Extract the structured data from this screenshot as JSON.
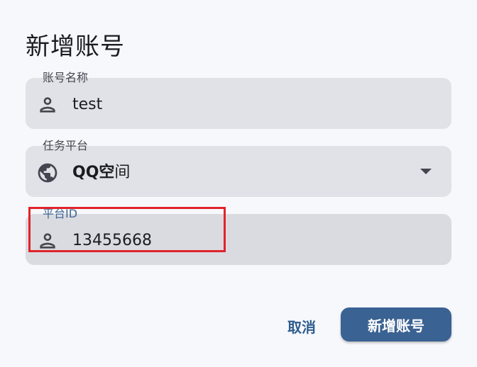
{
  "dialog": {
    "title": "新增账号"
  },
  "fields": {
    "account_name": {
      "label": "账号名称",
      "value": "test",
      "icon": "person-icon"
    },
    "platform": {
      "label": "任务平台",
      "value_bold": "QQ空",
      "value_light": "间",
      "icon": "globe-icon",
      "dropdown_icon": "arrow-drop-down-icon"
    },
    "platform_id": {
      "label": "平台ID",
      "value": "13455668",
      "icon": "person-icon"
    }
  },
  "actions": {
    "cancel_label": "取消",
    "submit_label": "新增账号"
  },
  "colors": {
    "background": "#f7f8fc",
    "field_fill": "#e1e2e7",
    "focused_field_fill": "#dadbe0",
    "primary": "#3a6292",
    "label_focused": "#3d6594",
    "highlight_box": "#e0242a"
  }
}
